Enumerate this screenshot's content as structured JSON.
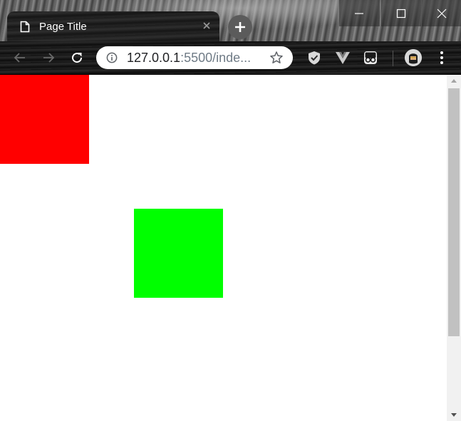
{
  "window": {
    "tab": {
      "title": "Page Title",
      "icon": "document-icon"
    },
    "controls": [
      "minimize",
      "maximize",
      "close"
    ]
  },
  "toolbar": {
    "url_host": "127.0.0.1",
    "url_rest": ":5500/inde...",
    "extensions": [
      "shield-check-icon",
      "vue-devtools-icon",
      "spy-extension-icon"
    ]
  },
  "page": {
    "boxes": [
      {
        "name": "red-square",
        "color": "#ff0000"
      },
      {
        "name": "green-square",
        "color": "#00ff00"
      }
    ]
  },
  "colors": {
    "accent_red": "#ff0000",
    "accent_green": "#00ff00",
    "scrollbar_thumb": "#c1c1c1"
  }
}
